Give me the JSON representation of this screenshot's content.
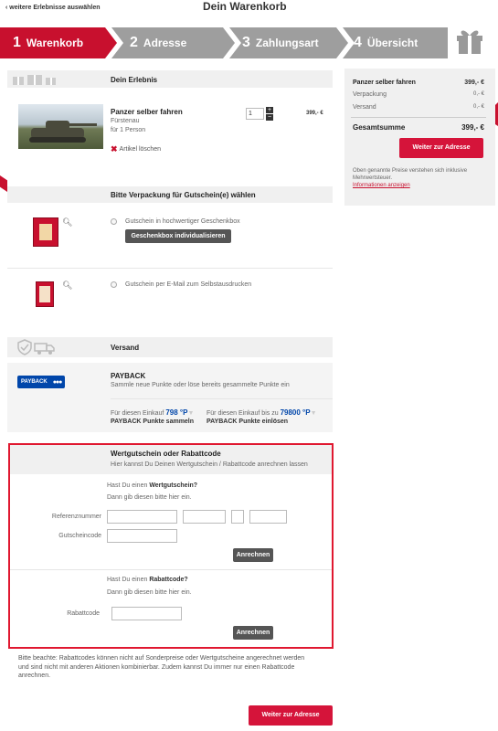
{
  "header": {
    "back_link": "‹ weitere Erlebnisse auswählen",
    "title": "Dein Warenkorb"
  },
  "steps": [
    {
      "num": "1",
      "label": "Warenkorb"
    },
    {
      "num": "2",
      "label": "Adresse"
    },
    {
      "num": "3",
      "label": "Zahlungsart"
    },
    {
      "num": "4",
      "label": "Übersicht"
    }
  ],
  "erlebnis": {
    "header": "Dein Erlebnis",
    "name": "Panzer selber fahren",
    "location": "Fürstenau",
    "persons": "für 1 Person",
    "quantity": "1",
    "price": "399,- €",
    "delete_label": "Artikel löschen"
  },
  "verpackung": {
    "header": "Bitte Verpackung für Gutschein(e) wählen",
    "option1": "Gutschein in hochwertiger Geschenkbox",
    "option1_button": "Geschenkbox individualisieren",
    "option2": "Gutschein per E-Mail zum Selbstausdrucken"
  },
  "versand": {
    "header": "Versand"
  },
  "payback": {
    "logo_text": "PAYBACK",
    "title": "PAYBACK",
    "desc": "Sammle neue Punkte oder löse bereits gesammelte Punkte ein",
    "collect_prefix": "Für diesen Einkauf",
    "collect_points": "798 °P",
    "collect_label": "PAYBACK Punkte sammeln",
    "redeem_prefix": "Für diesen Einkauf bis zu",
    "redeem_points": "79800 °P",
    "redeem_label": "PAYBACK Punkte einlösen"
  },
  "voucher": {
    "header": "Wertgutschein oder Rabattcode",
    "subheader": "Hier kannst Du Deinen Wertgutschein / Rabattcode anrechnen lassen",
    "q1_prefix": "Hast Du einen ",
    "q1_bold": "Wertgutschein?",
    "q1_sub": "Dann gib diesen bitte hier ein.",
    "ref_label": "Referenznummer",
    "code_label": "Gutscheincode",
    "apply_label": "Anrechnen",
    "q2_prefix": "Hast Du einen ",
    "q2_bold": "Rabattcode?",
    "q2_sub": "Dann gib diesen bitte hier ein.",
    "rabatt_label": "Rabattcode",
    "apply2_label": "Anrechnen"
  },
  "note": "Bitte beachte: Rabattcodes können nicht auf Sonderpreise oder Wertgutscheine angerechnet werden und sind nicht mit anderen Aktionen kombinierbar. Zudem kannst Du immer nur einen Rabattcode anrechnen.",
  "bottom_button": "Weiter zur Adresse",
  "summary": {
    "item": "Panzer selber fahren",
    "item_price": "399,- €",
    "verpackung": "Verpackung",
    "verpackung_price": "0,- €",
    "versand": "Versand",
    "versand_price": "0,- €",
    "total_label": "Gesamtsumme",
    "total_price": "399,- €",
    "button": "Weiter zur Adresse",
    "tax_note": "Oben genannte Preise verstehen sich inklusive Mehrwertsteuer.",
    "info_link": "Informationen anzeigen"
  },
  "colors": {
    "accent": "#c8102e",
    "step_inactive": "#9e9e9e",
    "payback_blue": "#0046aa"
  }
}
